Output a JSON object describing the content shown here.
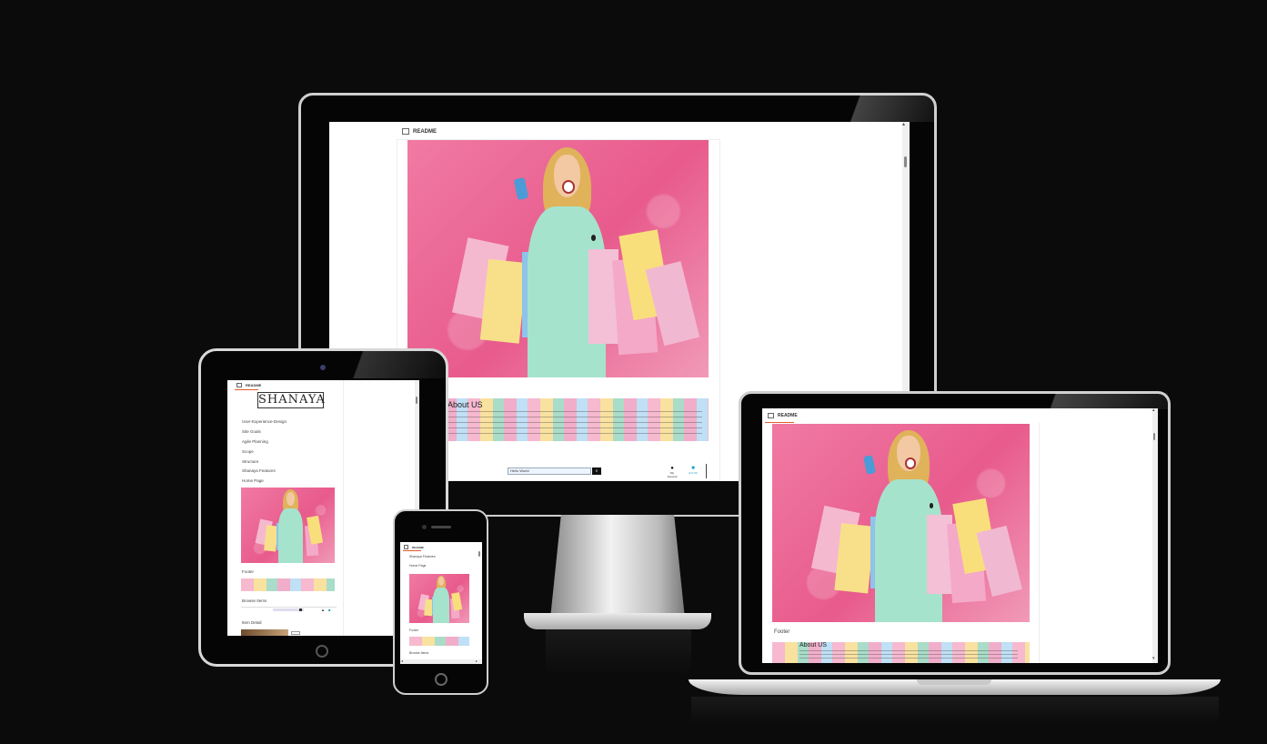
{
  "readme": {
    "tab_label": "README"
  },
  "monitor": {
    "about_title": "About US",
    "search": {
      "value": "Hello World"
    },
    "my_account_label": "My Account",
    "cart_label": "£17.00"
  },
  "tablet": {
    "logo_text": "SHANAYA",
    "toc": [
      "User-Experience-Design",
      "Site Goals",
      "Agile Planning",
      "Scope",
      "Structure",
      "Shanaya Features",
      "Home Page"
    ],
    "footer_label": "Footer",
    "browse_label": "Browse Items",
    "item_detail_label": "Item Detail"
  },
  "phone": {
    "toc": [
      "Shanaya Features",
      "Home Page"
    ],
    "footer_label": "Footer",
    "browse_label": "Browse Items"
  },
  "laptop": {
    "footer_label": "Footer",
    "about_title": "About US"
  },
  "colors": {
    "accent": "#e25d2e",
    "background": "#0b0b0b"
  }
}
